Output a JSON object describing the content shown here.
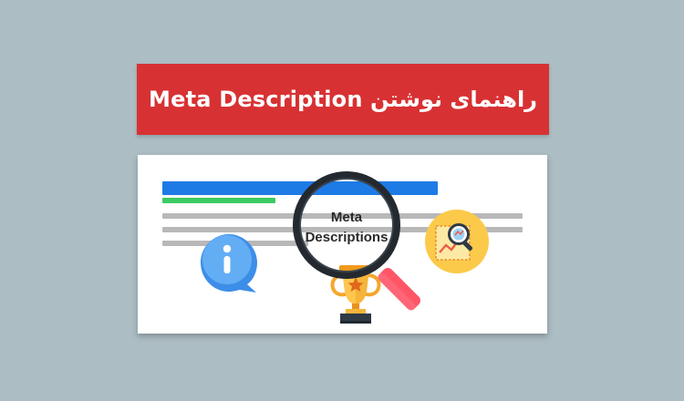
{
  "banner": {
    "title": "راهنمای نوشتن Meta Description",
    "background_color": "#d83133",
    "text_color": "#ffffff"
  },
  "card": {
    "magnifier_line1": "Meta",
    "magnifier_line2": "Descriptions",
    "bar_colors": {
      "title": "#1e7be6",
      "url": "#3ccb62",
      "snippet": "#b8b8b8"
    },
    "icons": [
      "info-speech-bubble-icon",
      "trophy-icon",
      "magnifying-glass-icon",
      "analytics-search-icon"
    ]
  },
  "page": {
    "background_color": "#acbdc3"
  }
}
